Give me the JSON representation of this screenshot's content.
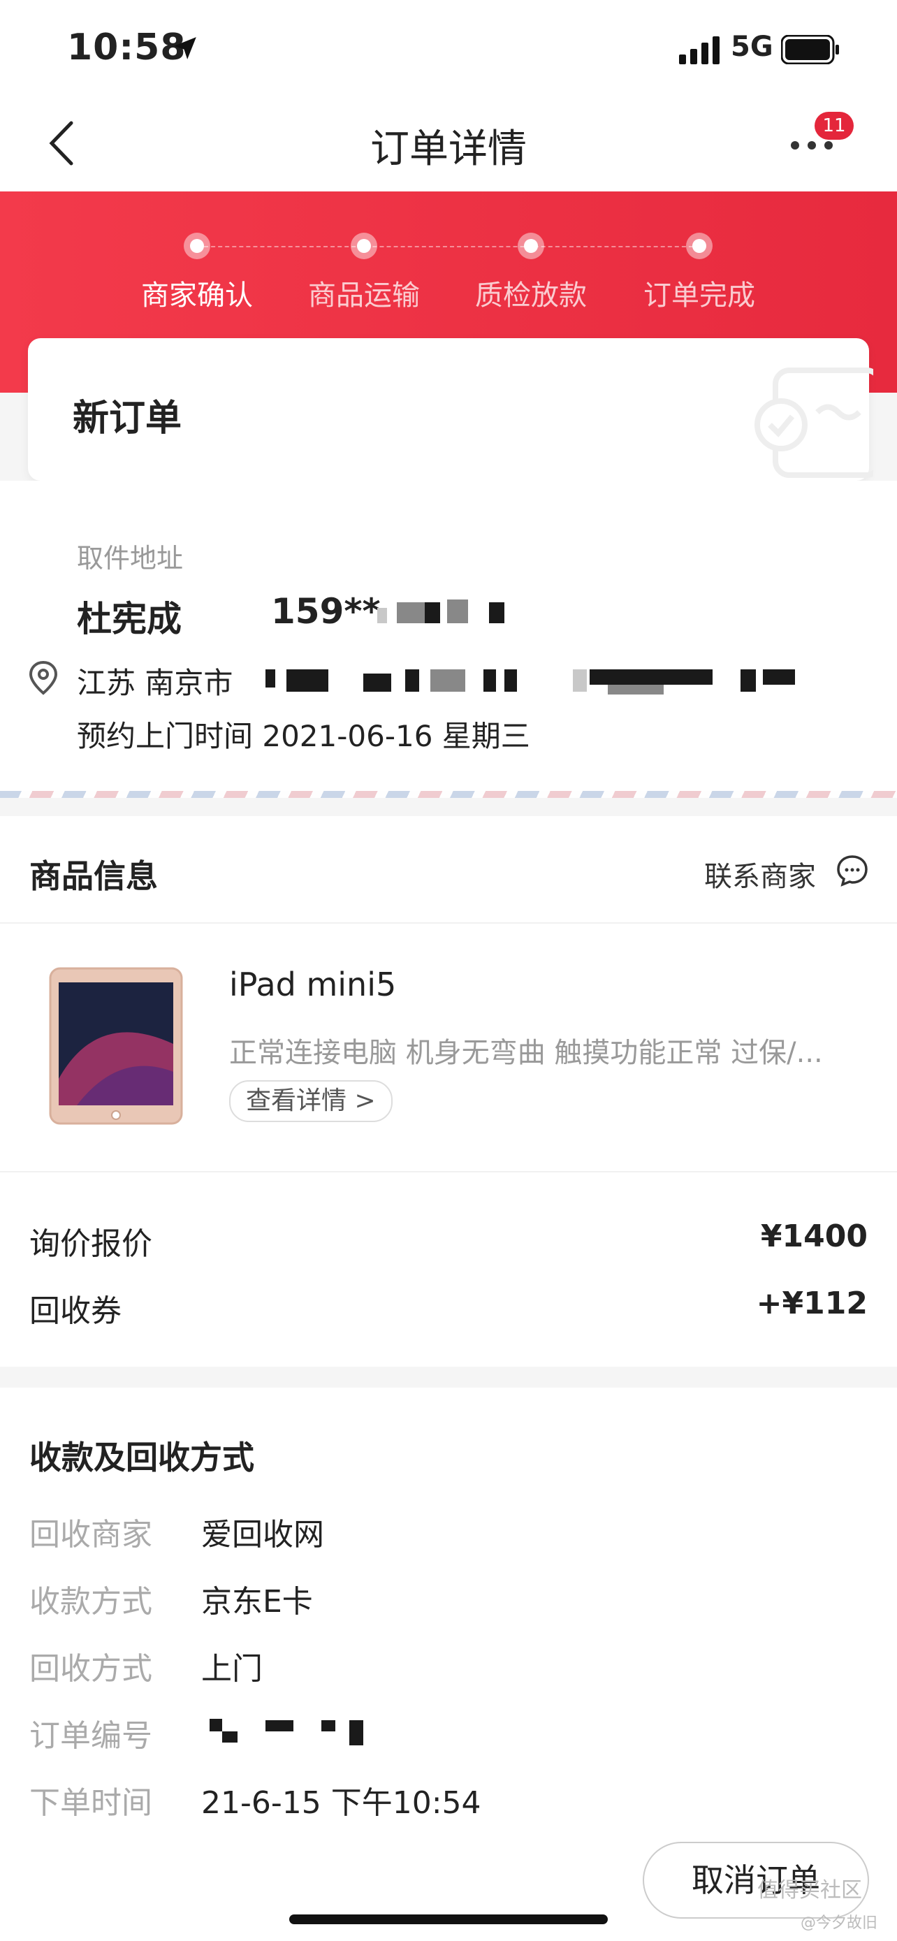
{
  "status_bar": {
    "time": "10:58",
    "network": "5G"
  },
  "nav": {
    "title": "订单详情",
    "badge": "11"
  },
  "steps": [
    {
      "label": "商家确认"
    },
    {
      "label": "商品运输"
    },
    {
      "label": "质检放款"
    },
    {
      "label": "订单完成"
    }
  ],
  "order": {
    "status": "新订单"
  },
  "address": {
    "label": "取件地址",
    "name": "杜宪成",
    "phone": "159**",
    "city": "江苏 南京市",
    "appointment": "预约上门时间 2021-06-16 星期三"
  },
  "product": {
    "section_title": "商品信息",
    "contact_label": "联系商家",
    "name": "iPad mini5",
    "description": "正常连接电脑 机身无弯曲 触摸功能正常 过保/...",
    "detail_button": "查看详情 >"
  },
  "pricing": [
    {
      "label": "询价报价",
      "value": "¥1400"
    },
    {
      "label": "回收券",
      "value": "+¥112"
    }
  ],
  "payment": {
    "title": "收款及回收方式",
    "rows": [
      {
        "label": "回收商家",
        "value": "爱回收网"
      },
      {
        "label": "收款方式",
        "value": "京东E卡"
      },
      {
        "label": "回收方式",
        "value": "上门"
      },
      {
        "label": "订单编号",
        "value": ""
      },
      {
        "label": "下单时间",
        "value": "21-6-15 下午10:54"
      }
    ]
  },
  "bottom": {
    "cancel_button": "取消订单"
  },
  "watermark": {
    "line1": "值得买社区",
    "line2": "@今夕故旧"
  },
  "colors": {
    "brand_red": "#e72a3e",
    "badge_red": "#e4263b"
  }
}
